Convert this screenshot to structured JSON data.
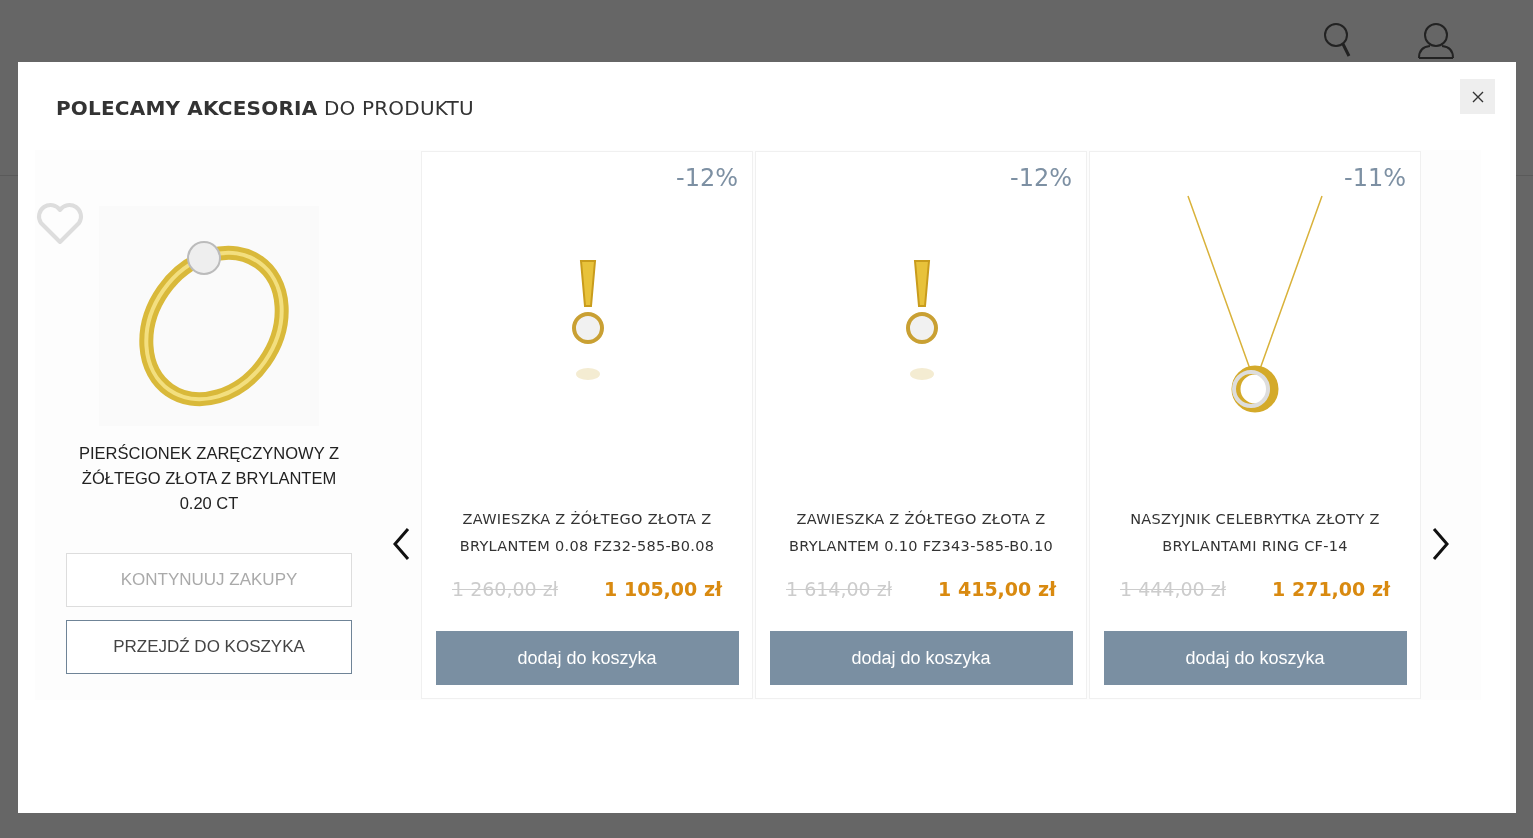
{
  "modal": {
    "title": "**POLECAMY AKCESORIA** DO PRODUKTU",
    "main_product": {
      "name": "PIERŚCIONEK ZARĘCZYNOWY Z ŻÓŁTEGO ZŁOTA Z BRYLANTEM 0.20 CT",
      "favorite": false,
      "kind": "ring"
    },
    "buttons": [
      {
        "label": "KONTYNUUJ ZAKUPY",
        "kind": "secondary"
      },
      {
        "label": "PRZEJDŹ DO KOSZYKA",
        "kind": "primary"
      }
    ],
    "products": [
      {
        "discount": "-12%",
        "name": "ZAWIESZKA Z ŻÓŁTEGO ZŁOTA Z BRYLANTEM 0.08 FZ32-585-B0.08",
        "old_price": "1 260,00 zł",
        "price": "1 105,00 zł",
        "button": "dodaj do koszyka",
        "kind": "pendant"
      },
      {
        "discount": "-12%",
        "name": "ZAWIESZKA Z ŻÓŁTEGO ZŁOTA Z BRYLANTEM 0.10 FZ343-585-B0.10",
        "old_price": "1 614,00 zł",
        "price": "1 415,00 zł",
        "button": "dodaj do koszyka",
        "kind": "pendant"
      },
      {
        "discount": "-11%",
        "name": "NASZYJNIK CELEBRYTKA ZŁOTY Z BRYLANTAMI RING CF-14",
        "old_price": "1 444,00 zł",
        "price": "1 271,00 zł",
        "button": "dodaj do koszyka",
        "kind": "necklace"
      }
    ]
  }
}
